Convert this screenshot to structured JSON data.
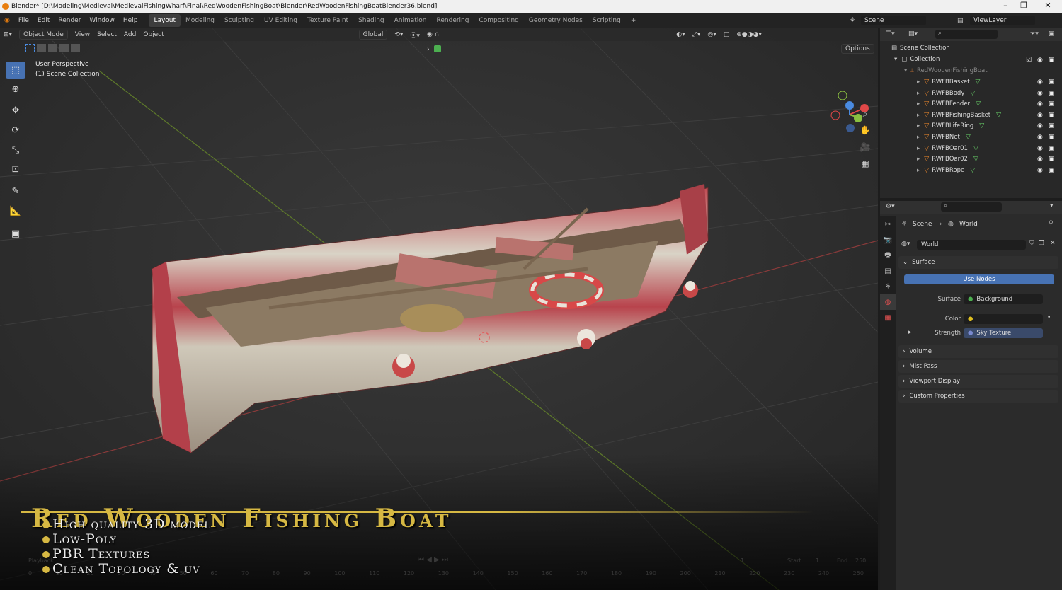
{
  "window": {
    "title": "Blender* [D:\\Modeling\\Medieval\\MedievalFishingWharf\\Final\\RedWoodenFishingBoat\\Blender\\RedWoodenFishingBoatBlender36.blend]"
  },
  "menu": [
    "File",
    "Edit",
    "Render",
    "Window",
    "Help"
  ],
  "workspaces": [
    {
      "label": "Layout",
      "active": true
    },
    {
      "label": "Modeling"
    },
    {
      "label": "Sculpting"
    },
    {
      "label": "UV Editing"
    },
    {
      "label": "Texture Paint"
    },
    {
      "label": "Shading"
    },
    {
      "label": "Animation"
    },
    {
      "label": "Rendering"
    },
    {
      "label": "Compositing"
    },
    {
      "label": "Geometry Nodes"
    },
    {
      "label": "Scripting"
    }
  ],
  "topright": {
    "scene": "Scene",
    "viewlayer": "ViewLayer"
  },
  "viewport": {
    "mode": "Object Mode",
    "menus": [
      "View",
      "Select",
      "Add",
      "Object"
    ],
    "transform": "Global",
    "options": "Options",
    "perspective": "User Perspective",
    "collection": "(1) Scene Collection"
  },
  "outliner": {
    "root": "Scene Collection",
    "collection": "Collection",
    "parent": "RedWoodenFishingBoat",
    "items": [
      "RWFBBasket",
      "RWFBBody",
      "RWFBFender",
      "RWFBFishingBasket",
      "RWFBLifeRing",
      "RWFBNet",
      "RWFBOar01",
      "RWFBOar02",
      "RWFBRope"
    ]
  },
  "properties": {
    "breadcrumb_scene": "Scene",
    "breadcrumb_world": "World",
    "world_name": "World",
    "surface_panel": "Surface",
    "use_nodes": "Use Nodes",
    "surface_label": "Surface",
    "surface_value": "Background",
    "color_label": "Color",
    "strength_label": "Strength",
    "strength_value": "Sky Texture",
    "panels": [
      "Volume",
      "Mist Pass",
      "Viewport Display",
      "Custom Properties"
    ]
  },
  "timeline": {
    "playback": "Playback",
    "frame": "1",
    "start_label": "Start",
    "start": "1",
    "end_label": "End",
    "end": "250",
    "ticks": [
      "0",
      "10",
      "20",
      "30",
      "40",
      "50",
      "60",
      "70",
      "80",
      "90",
      "100",
      "110",
      "120",
      "130",
      "140",
      "150",
      "160",
      "170",
      "180",
      "190",
      "200",
      "210",
      "220",
      "230",
      "240",
      "250"
    ]
  },
  "overlay": {
    "title": "Red Wooden Fishing Boat",
    "bullets": [
      "High quality 3D model",
      "Low-Poly",
      "PBR Textures",
      "Clean Topology & uv"
    ]
  },
  "colors": {
    "accent": "#4772b3",
    "gold": "#d6b843",
    "boat_red": "#b3404a",
    "boat_white": "#d8d2c4"
  }
}
